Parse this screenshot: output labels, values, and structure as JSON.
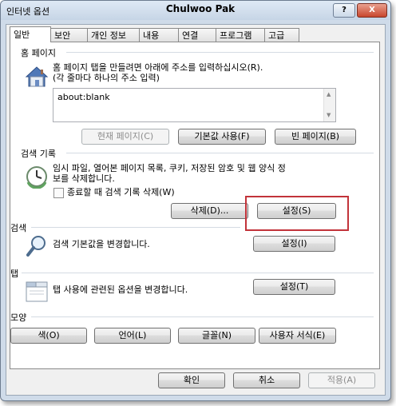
{
  "window": {
    "title_left": "인터넷 옵션",
    "title_center": "Chulwoo Pak",
    "help_label": "?",
    "close_label": "X"
  },
  "tabs": [
    {
      "label": "일반"
    },
    {
      "label": "보안"
    },
    {
      "label": "개인 정보"
    },
    {
      "label": "내용"
    },
    {
      "label": "연결"
    },
    {
      "label": "프로그램"
    },
    {
      "label": "고급"
    }
  ],
  "home": {
    "section": "홈 페이지",
    "desc_line1": "홈 페이지 탭을 만들려면 아래에 주소를 입력하십시오(R).",
    "desc_line2": "(각 줄마다 하나의 주소 입력)",
    "url_value": "about:blank",
    "btn_current": "현재 페이지(C)",
    "btn_default": "기본값 사용(F)",
    "btn_blank": "빈 페이지(B)"
  },
  "history": {
    "section": "검색 기록",
    "desc_line1": "임시 파일, 열어본 페이지 목록, 쿠키, 저장된 암호 및 웹 양식 정",
    "desc_line2": "보를 삭제합니다.",
    "checkbox_label": "종료할 때 검색 기록 삭제(W)",
    "btn_delete": "삭제(D)...",
    "btn_settings": "설정(S)"
  },
  "search": {
    "section": "검색",
    "desc": "검색 기본값을 변경합니다.",
    "btn_settings": "설정(I)"
  },
  "tabs_section": {
    "section": "탭",
    "desc": "탭 사용에 관련된 옵션을 변경합니다.",
    "btn_settings": "설정(T)"
  },
  "appearance": {
    "section": "모양",
    "btn_colors": "색(O)",
    "btn_languages": "언어(L)",
    "btn_fonts": "글꼴(N)",
    "btn_accessibility": "사용자 서식(E)"
  },
  "footer": {
    "btn_ok": "확인",
    "btn_cancel": "취소",
    "btn_apply": "적용(A)"
  },
  "colors": {
    "highlight": "#c2333a",
    "window_chrome": "#cfdbe9"
  }
}
